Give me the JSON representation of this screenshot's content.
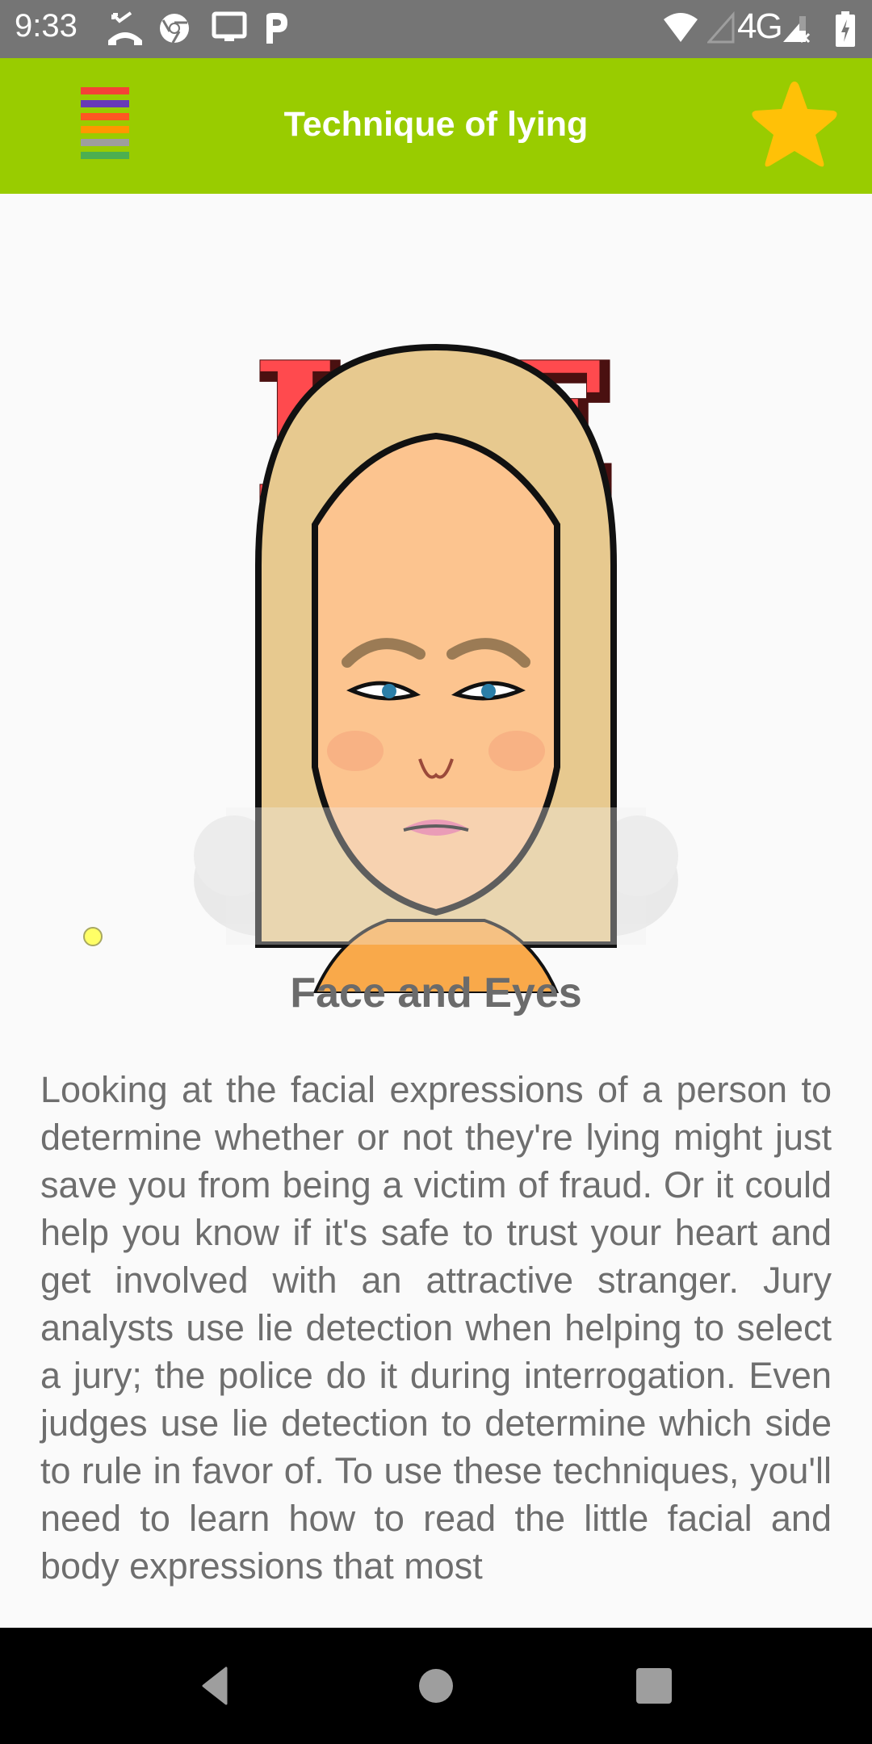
{
  "status_bar": {
    "time": "9:33",
    "left_icons": [
      "missed-call-icon",
      "chrome-icon",
      "cast-screen-icon",
      "p-app-icon"
    ],
    "right_icons": [
      "wifi-icon",
      "signal-empty-icon",
      "network-type-icon",
      "signal-x-icon",
      "battery-charging-icon"
    ],
    "network_type": "4G"
  },
  "toolbar": {
    "title": "Technique of lying",
    "menu_icon": "menu-icon",
    "menu_colors": [
      "#f44336",
      "#673ab7",
      "#ff5722",
      "#ff9800",
      "#9e9e9e",
      "#4caf50"
    ],
    "favorite_icon": "star-icon",
    "background": "#99cc00",
    "star_color": "#ffc107"
  },
  "content": {
    "image_text": "LIE",
    "image_description": "angry-woman-avatar",
    "heading": "Face and Eyes",
    "body": "Looking at the facial expressions of a person to determine whether or not they're lying might just save you from being a victim of fraud. Or it could help you know if it's safe to trust your heart and get involved with an attractive stranger. Jury analysts use lie detection when helping to select a jury; the police do it during interrogation. Even judges use lie detection to determine which side to rule in favor of. To use these techniques, you'll need to learn how to read the little facial and body expressions that most"
  },
  "nav_bar": {
    "back": "back-icon",
    "home": "home-icon",
    "recents": "recents-icon"
  }
}
